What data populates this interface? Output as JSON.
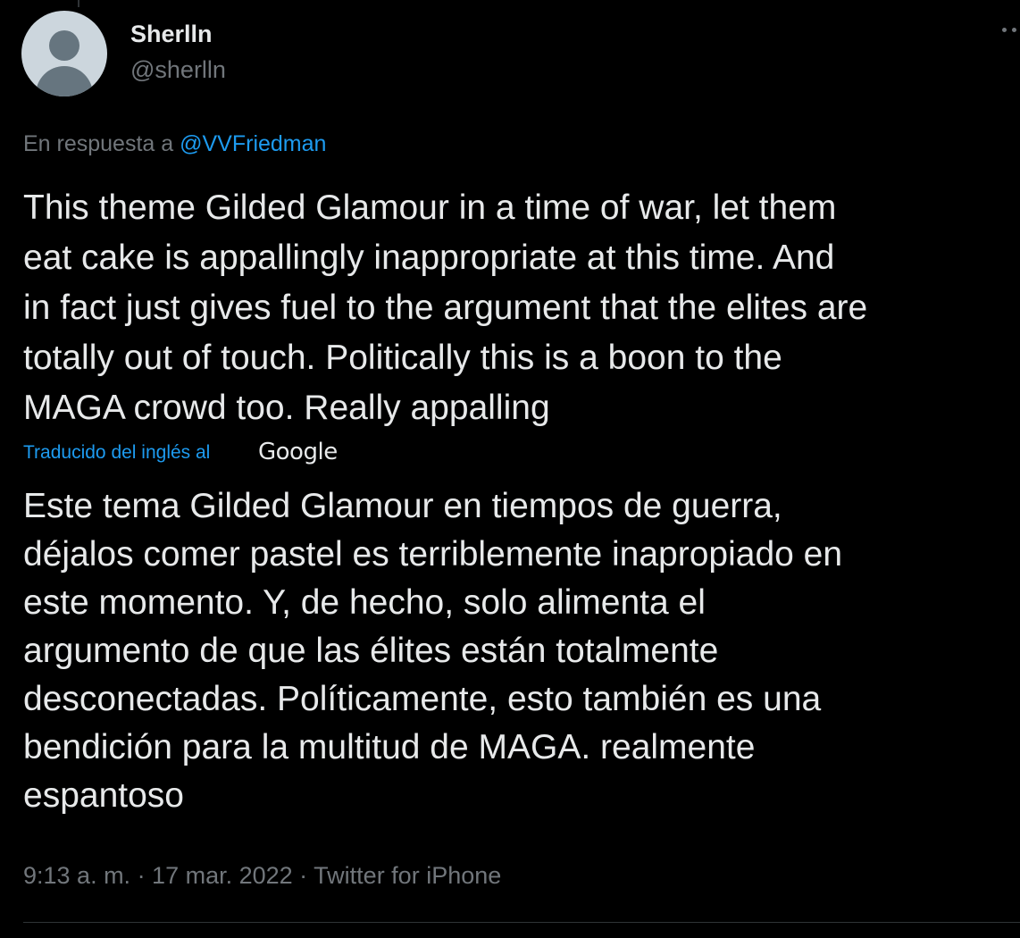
{
  "tweet": {
    "display_name": "Sherlln",
    "handle": "@sherlln",
    "reply_prefix": "En respuesta a",
    "reply_to": "@VVFriedman",
    "text": "This theme Gilded Glamour in a time of war, let them\neat cake is appallingly inappropriate at this time. And\nin fact just gives fuel to the argument that the elites are\ntotally out of touch. Politically this is a boon to the\nMAGA crowd too. Really appalling",
    "translated_label": "Traducido del inglés al",
    "translator": "Google",
    "translation": "Este tema Gilded Glamour en tiempos de guerra,\ndéjalos comer pastel es terriblemente inapropiado en\neste momento. Y, de hecho, solo alimenta el\nargumento de que las élites están totalmente\ndesconectadas. Políticamente, esto también es una\nbendición para la multitud de MAGA. realmente\nespantoso",
    "meta": "9:13 a. m. · 17 mar. 2022 · Twitter for iPhone"
  },
  "icons": {
    "avatar": "default-profile-avatar-icon",
    "more": "more-options-icon"
  },
  "colors": {
    "background": "#000000",
    "text": "#e7e9ea",
    "secondary": "#71767b",
    "link": "#1d9bf0",
    "divider": "#2f3336"
  }
}
